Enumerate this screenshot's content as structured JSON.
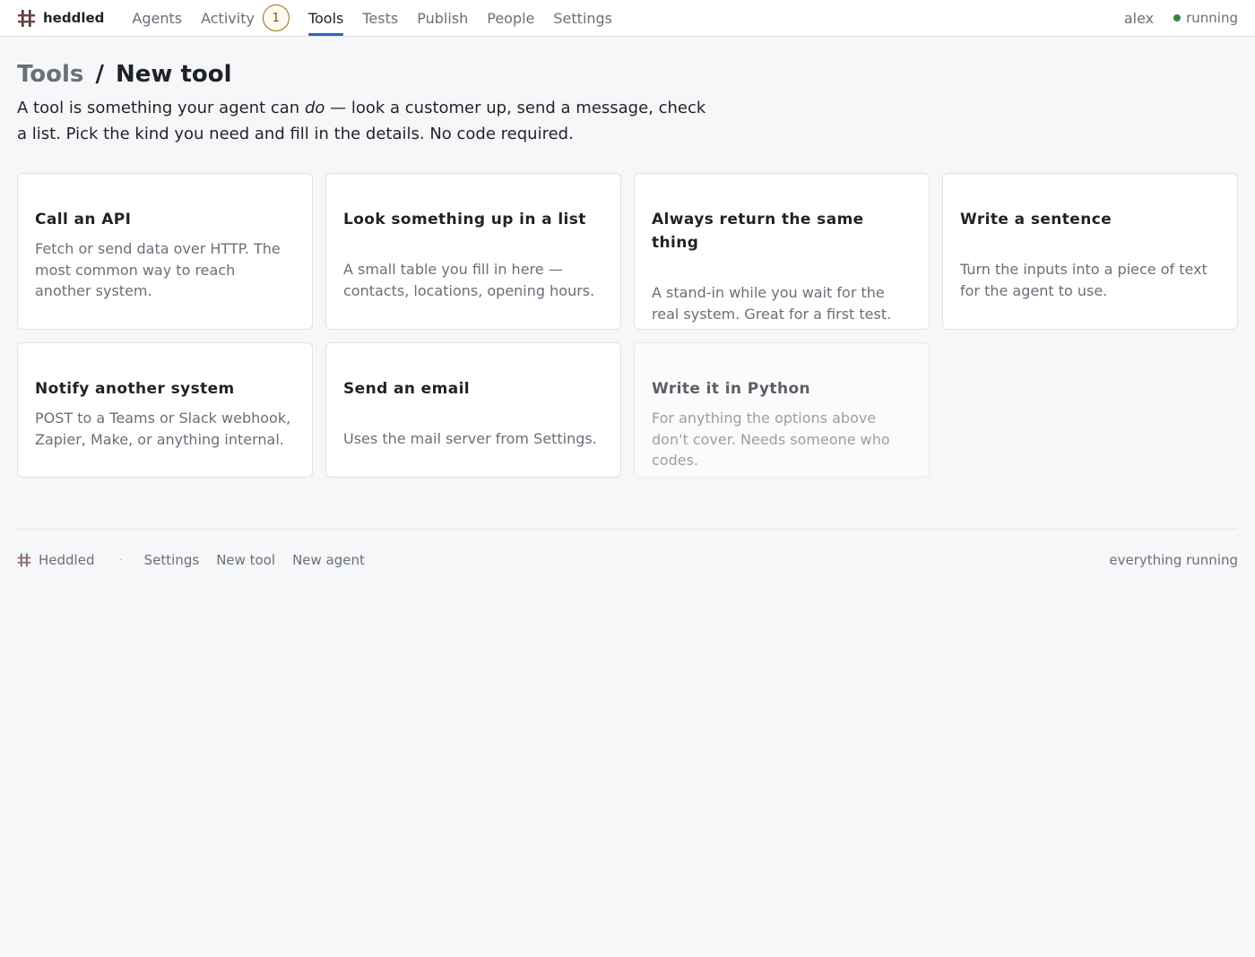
{
  "header": {
    "brand": "heddled",
    "nav": [
      {
        "label": "Agents"
      },
      {
        "label": "Activity",
        "badge": "1"
      },
      {
        "label": "Tools",
        "active": true
      },
      {
        "label": "Tests"
      },
      {
        "label": "Publish"
      },
      {
        "label": "People"
      },
      {
        "label": "Settings"
      }
    ],
    "user": "alex",
    "status": "running"
  },
  "page": {
    "breadcrumb_parent": "Tools",
    "breadcrumb_sep": "/",
    "title": "New tool",
    "intro_before": "A tool is something your agent can ",
    "intro_em": "do",
    "intro_after": " — look a customer up, send a message, check a list. Pick the kind you need and fill in the details. No code required."
  },
  "tool_types": [
    {
      "title": "Call an API",
      "description": "Fetch or send data over HTTP. The most common way to reach another system."
    },
    {
      "title": "Look something up in a list",
      "description": "A small table you fill in here — contacts, locations, opening hours."
    },
    {
      "title": "Always return the same thing",
      "description": "A stand-in while you wait for the real system. Great for a first test."
    },
    {
      "title": "Write a sentence",
      "description": "Turn the inputs into a piece of text for the agent to use."
    },
    {
      "title": "Notify another system",
      "description": "POST to a Teams or Slack webhook, Zapier, Make, or anything internal."
    },
    {
      "title": "Send an email",
      "description": "Uses the mail server from Settings."
    },
    {
      "title": "Write it in Python",
      "description": "For anything the options above don't cover. Needs someone who codes."
    }
  ],
  "footer": {
    "brand": "Heddled",
    "separator": "·",
    "links": [
      "Settings",
      "New tool",
      "New agent"
    ],
    "status": "everything running"
  },
  "colors": {
    "accent": "#2f62c4",
    "status_ok": "#2e8b3a",
    "badge_border": "#9a6a1a",
    "logo": "#7a2e2e"
  },
  "icons": {
    "brand": "hash-weave-icon",
    "status": "status-dot-icon"
  }
}
